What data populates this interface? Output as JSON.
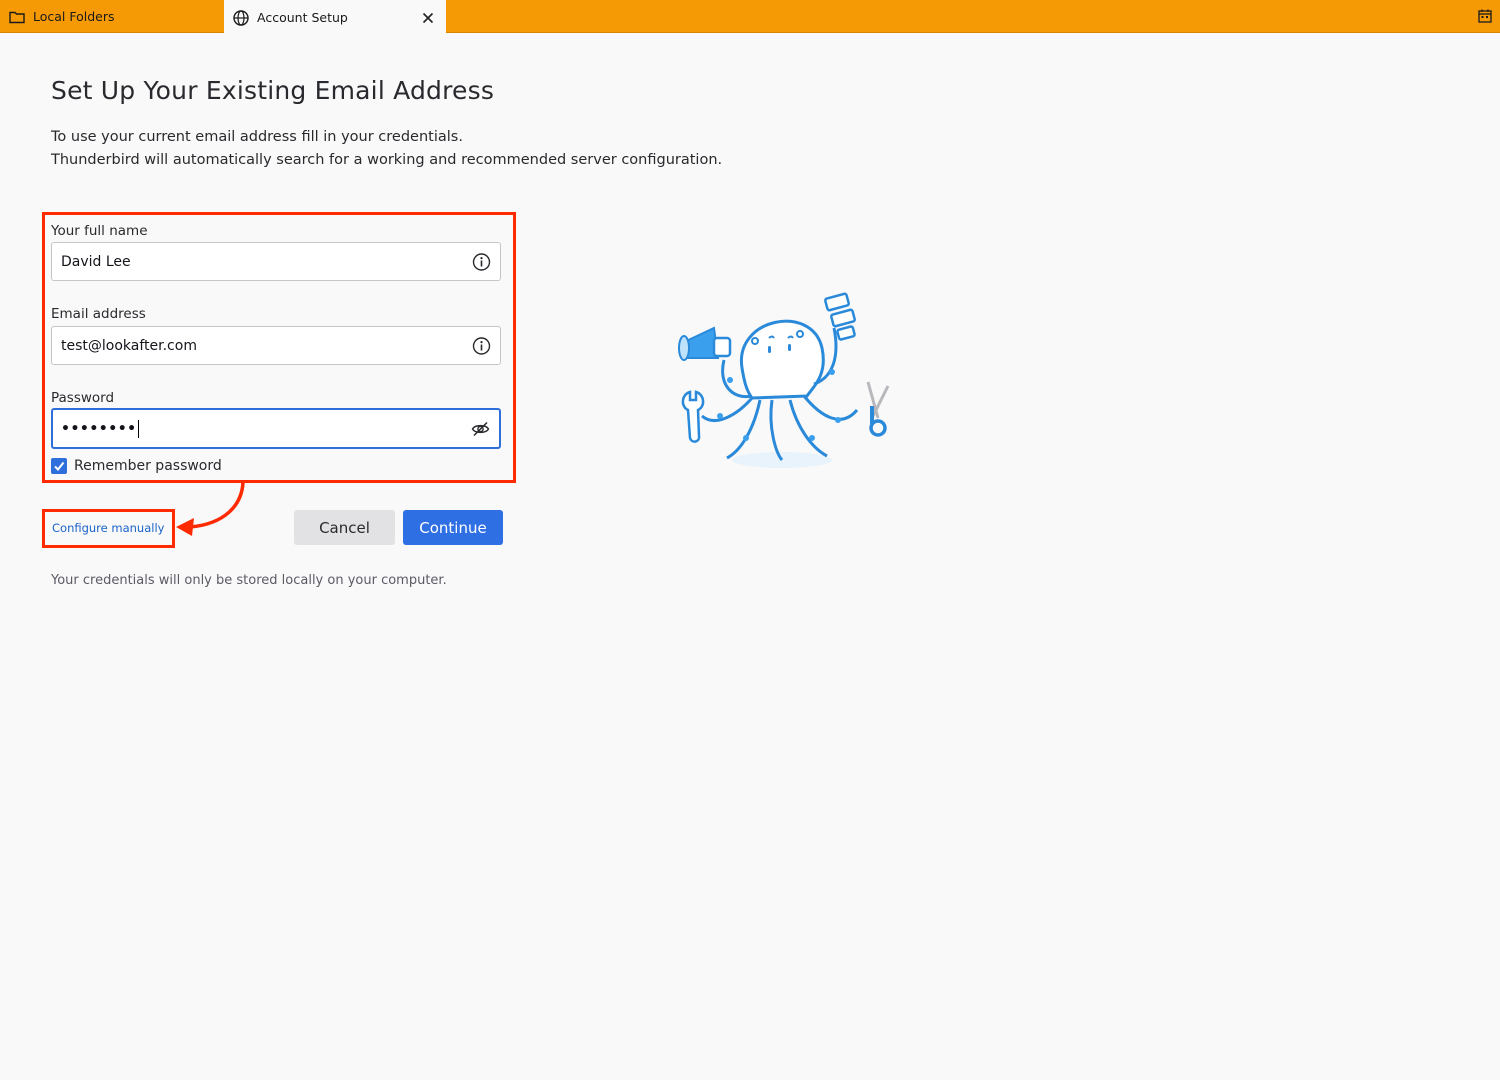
{
  "tabs": [
    {
      "label": "Local Folders",
      "icon": "folder-icon"
    },
    {
      "label": "Account Setup",
      "icon": "globe-icon"
    }
  ],
  "page": {
    "title": "Set Up Your Existing Email Address",
    "description_line1": "To use your current email address fill in your credentials.",
    "description_line2": "Thunderbird will automatically search for a working and recommended server configuration."
  },
  "form": {
    "full_name": {
      "label": "Your full name",
      "value": "David Lee"
    },
    "email": {
      "label": "Email address",
      "value": "test@lookafter.com"
    },
    "password": {
      "label": "Password",
      "value": "••••••••"
    },
    "remember_password": {
      "label": "Remember password",
      "checked": true
    }
  },
  "actions": {
    "configure_manually": "Configure manually",
    "cancel": "Cancel",
    "continue": "Continue"
  },
  "footer_note": "Your credentials will only be stored locally on your computer.",
  "colors": {
    "tabbar": "#f59a05",
    "accent": "#2f6fe4",
    "annotation": "#ff2a00"
  }
}
